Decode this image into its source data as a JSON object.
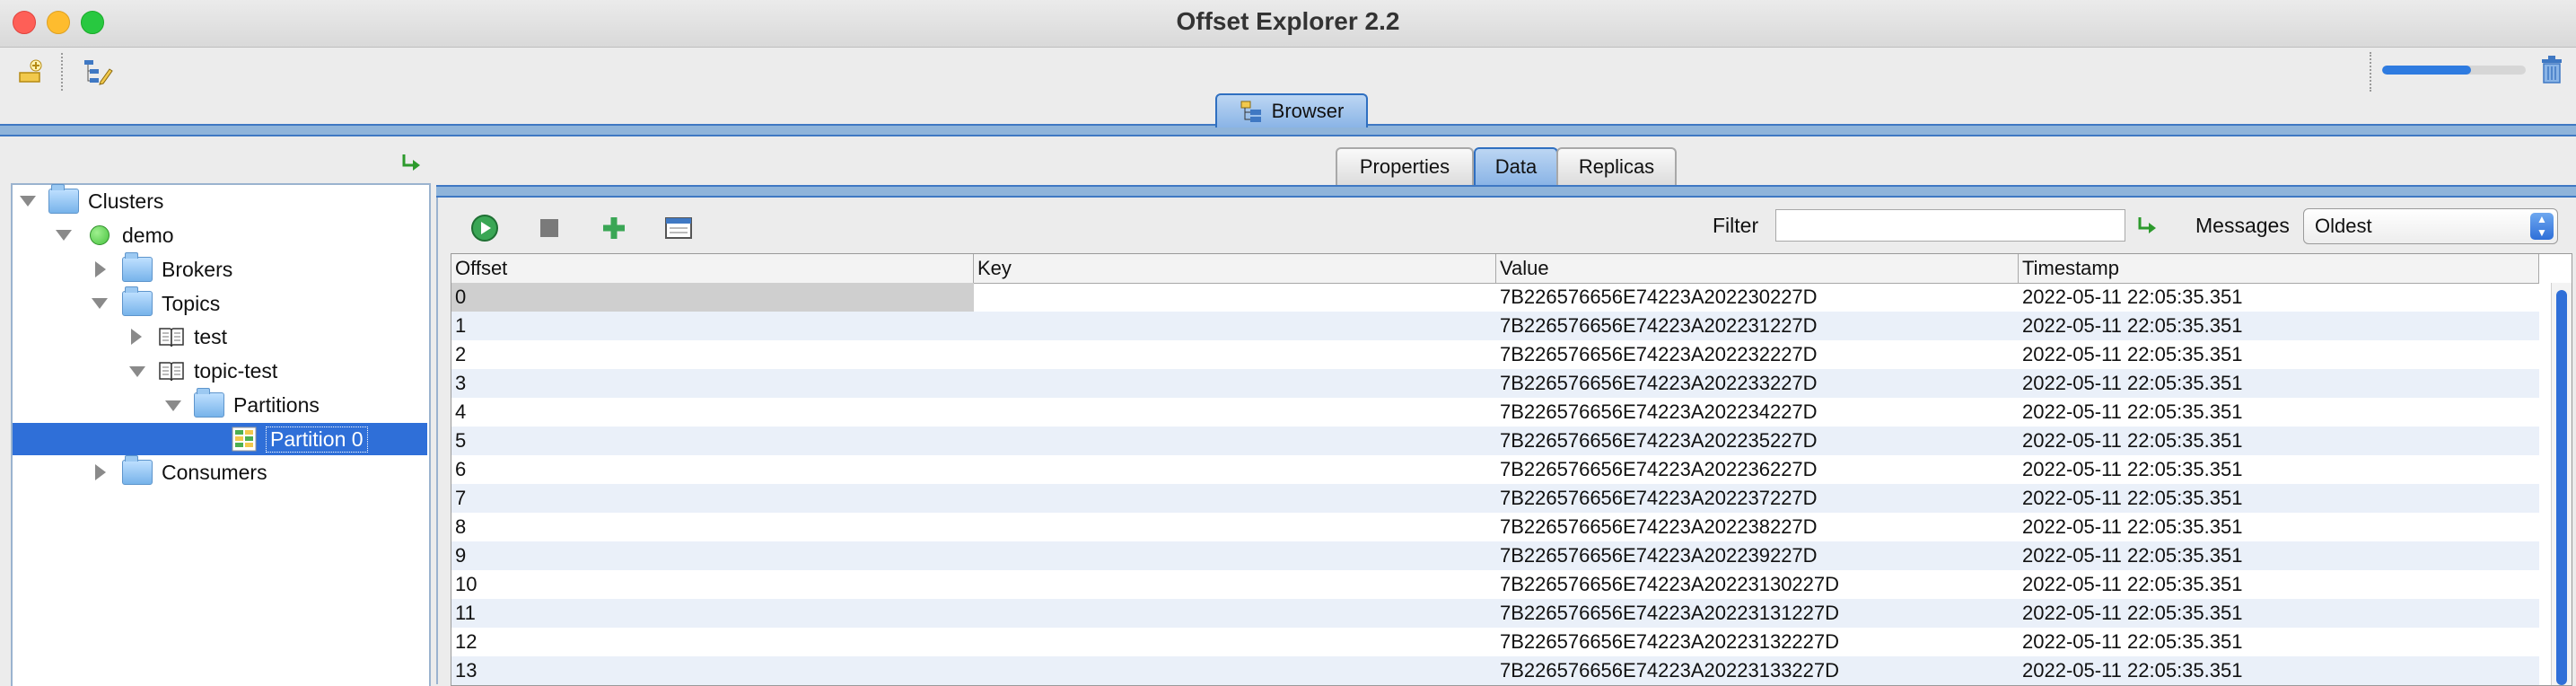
{
  "window": {
    "title": "Offset Explorer  2.2"
  },
  "toolbar": {
    "progress_fraction": 0.62
  },
  "browser_tab": {
    "label": "Browser"
  },
  "tree": {
    "root": "Clusters",
    "cluster": "demo",
    "brokers": "Brokers",
    "topics": "Topics",
    "topic1": "test",
    "topic2": "topic-test",
    "partitions": "Partitions",
    "partition0": "Partition 0",
    "consumers": "Consumers"
  },
  "tabs": [
    "Properties",
    "Data",
    "Replicas"
  ],
  "active_tab": "Data",
  "filter": {
    "label": "Filter",
    "value": ""
  },
  "messages": {
    "label": "Messages",
    "selected": "Oldest"
  },
  "table": {
    "columns": [
      "Offset",
      "Key",
      "Value",
      "Timestamp"
    ],
    "rows": [
      {
        "offset": "0",
        "key": "",
        "value": "7B226576656E74223A202230227D",
        "timestamp": "2022-05-11 22:05:35.351"
      },
      {
        "offset": "1",
        "key": "",
        "value": "7B226576656E74223A202231227D",
        "timestamp": "2022-05-11 22:05:35.351"
      },
      {
        "offset": "2",
        "key": "",
        "value": "7B226576656E74223A202232227D",
        "timestamp": "2022-05-11 22:05:35.351"
      },
      {
        "offset": "3",
        "key": "",
        "value": "7B226576656E74223A202233227D",
        "timestamp": "2022-05-11 22:05:35.351"
      },
      {
        "offset": "4",
        "key": "",
        "value": "7B226576656E74223A202234227D",
        "timestamp": "2022-05-11 22:05:35.351"
      },
      {
        "offset": "5",
        "key": "",
        "value": "7B226576656E74223A202235227D",
        "timestamp": "2022-05-11 22:05:35.351"
      },
      {
        "offset": "6",
        "key": "",
        "value": "7B226576656E74223A202236227D",
        "timestamp": "2022-05-11 22:05:35.351"
      },
      {
        "offset": "7",
        "key": "",
        "value": "7B226576656E74223A202237227D",
        "timestamp": "2022-05-11 22:05:35.351"
      },
      {
        "offset": "8",
        "key": "",
        "value": "7B226576656E74223A202238227D",
        "timestamp": "2022-05-11 22:05:35.351"
      },
      {
        "offset": "9",
        "key": "",
        "value": "7B226576656E74223A202239227D",
        "timestamp": "2022-05-11 22:05:35.351"
      },
      {
        "offset": "10",
        "key": "",
        "value": "7B226576656E74223A20223130227D",
        "timestamp": "2022-05-11 22:05:35.351"
      },
      {
        "offset": "11",
        "key": "",
        "value": "7B226576656E74223A20223131227D",
        "timestamp": "2022-05-11 22:05:35.351"
      },
      {
        "offset": "12",
        "key": "",
        "value": "7B226576656E74223A20223132227D",
        "timestamp": "2022-05-11 22:05:35.351"
      },
      {
        "offset": "13",
        "key": "",
        "value": "7B226576656E74223A20223133227D",
        "timestamp": "2022-05-11 22:05:35.351"
      }
    ]
  },
  "colors": {
    "accent": "#2f6fd8",
    "close": "#fe5f57",
    "minimize": "#febc2e",
    "zoom": "#28c840",
    "cluster_status": "#49c340"
  }
}
